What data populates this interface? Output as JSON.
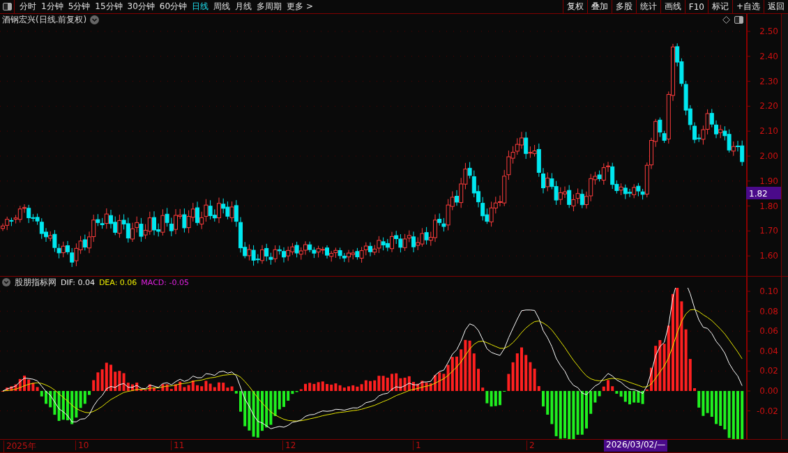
{
  "toolbar": {
    "periods": [
      {
        "label": "分时",
        "selected": false
      },
      {
        "label": "1分钟",
        "selected": false
      },
      {
        "label": "5分钟",
        "selected": false
      },
      {
        "label": "15分钟",
        "selected": false
      },
      {
        "label": "30分钟",
        "selected": false
      },
      {
        "label": "60分钟",
        "selected": false
      },
      {
        "label": "日线",
        "selected": true
      },
      {
        "label": "周线",
        "selected": false
      },
      {
        "label": "月线",
        "selected": false
      },
      {
        "label": "多周期",
        "selected": false
      },
      {
        "label": "更多 >",
        "selected": false
      }
    ],
    "actions": [
      "复权",
      "叠加",
      "多股",
      "统计",
      "画线",
      "F10",
      "标记",
      "+自选",
      "返回"
    ]
  },
  "chart": {
    "title": "酒钢宏兴(日线.前复权)",
    "price_ticks": [
      "2.50",
      "2.40",
      "2.30",
      "2.20",
      "2.10",
      "2.00",
      "1.90",
      "1.80",
      "1.70",
      "1.60"
    ],
    "current_price": "1.82"
  },
  "indicator": {
    "name": "股朋指标网",
    "dif": "DIF: 0.04",
    "dea": "DEA: 0.06",
    "macd": "MACD: -0.05",
    "ticks": [
      "0.10",
      "0.08",
      "0.06",
      "0.04",
      "0.02",
      "0.00",
      "-0.02"
    ]
  },
  "time_axis": {
    "labels": [
      "2025年",
      "10",
      "11",
      "12",
      "1",
      "2"
    ],
    "cursor_date": "2026/03/02/—"
  }
}
